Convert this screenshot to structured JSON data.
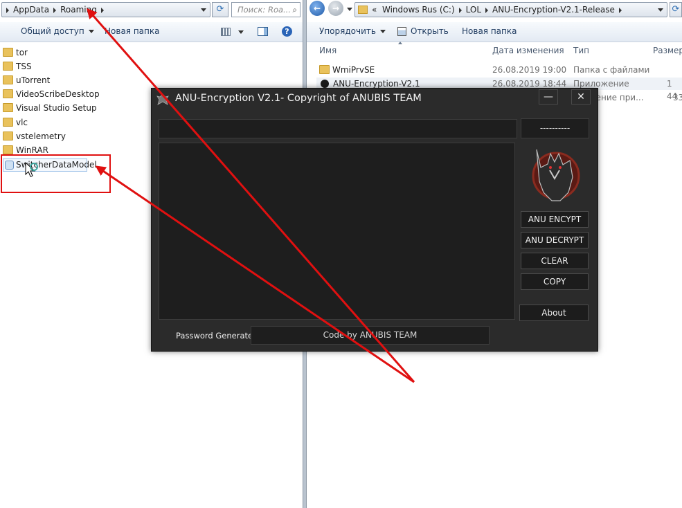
{
  "left_explorer": {
    "breadcrumb": [
      "AppData",
      "Roaming"
    ],
    "search_placeholder": "Поиск: Roa...",
    "toolbar": {
      "share": "Общий доступ",
      "new_folder": "Новая папка"
    },
    "items": [
      "tor",
      "TSS",
      "uTorrent",
      "VideoScribeDesktop",
      "Visual Studio Setup",
      "vlc",
      "vstelemetry",
      "WinRAR"
    ],
    "selected_item": "SwitcherDataModel"
  },
  "right_explorer": {
    "path_prefix": "«",
    "breadcrumb": [
      "Windows Rus (C:)",
      "LOL",
      "ANU-Encryption-V2.1-Release"
    ],
    "toolbar": {
      "organize": "Упорядочить",
      "open": "Открыть",
      "new_folder": "Новая папка"
    },
    "columns": {
      "name": "Имя",
      "date": "Дата изменения",
      "type": "Тип",
      "size": "Размер"
    },
    "rows": [
      {
        "name": "WmiPrvSE",
        "date": "26.08.2019 19:00",
        "type": "Папка с файлами",
        "size": ""
      },
      {
        "name": "ANU-Encryption-V2.1",
        "date": "26.08.2019 18:44",
        "type": "Приложение",
        "size": "1 44"
      },
      {
        "name": "",
        "date": "",
        "type": "рение при...",
        "size": "33"
      }
    ]
  },
  "app": {
    "title": "ANU-Encryption V2.1- Copyright of ANUBIS TEAM",
    "minimize": "—",
    "close": "✕",
    "key_display": "----------",
    "buttons": {
      "encrypt": "ANU ENCYPT",
      "decrypt": "ANU DECRYPT",
      "clear": "CLEAR",
      "copy": "COPY",
      "about": "About"
    },
    "password_label": "Password Generate:",
    "footer_text": "Code by ANUBIS TEAM"
  },
  "colors": {
    "annotation": "#e01010",
    "app_bg": "#2b2b2b",
    "folder": "#e9c25c"
  }
}
